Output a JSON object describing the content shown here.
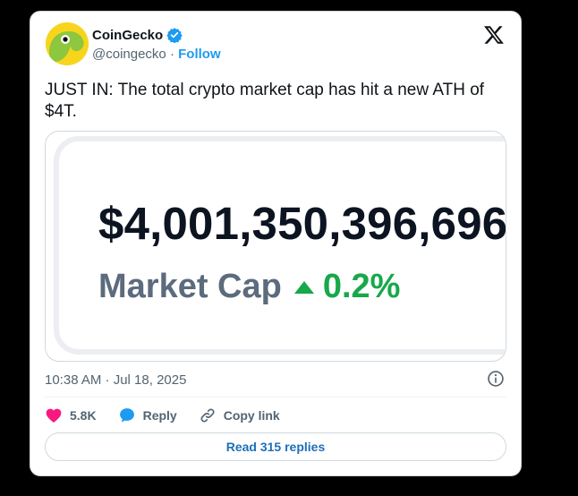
{
  "colors": {
    "accent": "#1d9bf0",
    "like": "#f91880",
    "positive": "#17a84a",
    "logo_bg": "#f7d51d",
    "logo_green": "#8dc63f"
  },
  "author": {
    "name": "CoinGecko",
    "handle": "@coingecko",
    "separator": "·",
    "follow_label": "Follow",
    "avatar_icon": "coingecko-logo",
    "verified_icon": "verified-badge-icon"
  },
  "platform_icon": "x-logo",
  "tweet": {
    "text": "JUST IN: The total crypto market cap has hit a new ATH of $4T."
  },
  "media": {
    "value": "$4,001,350,396,696",
    "label": "Market Cap",
    "change_icon": "triangle-up-icon",
    "change": "0.2%"
  },
  "meta": {
    "timestamp": "10:38 AM · Jul 18, 2025",
    "info_icon": "info-icon"
  },
  "actions": {
    "likes_count": "5.8K",
    "reply_label": "Reply",
    "copy_label": "Copy link"
  },
  "read_replies_label": "Read 315 replies"
}
